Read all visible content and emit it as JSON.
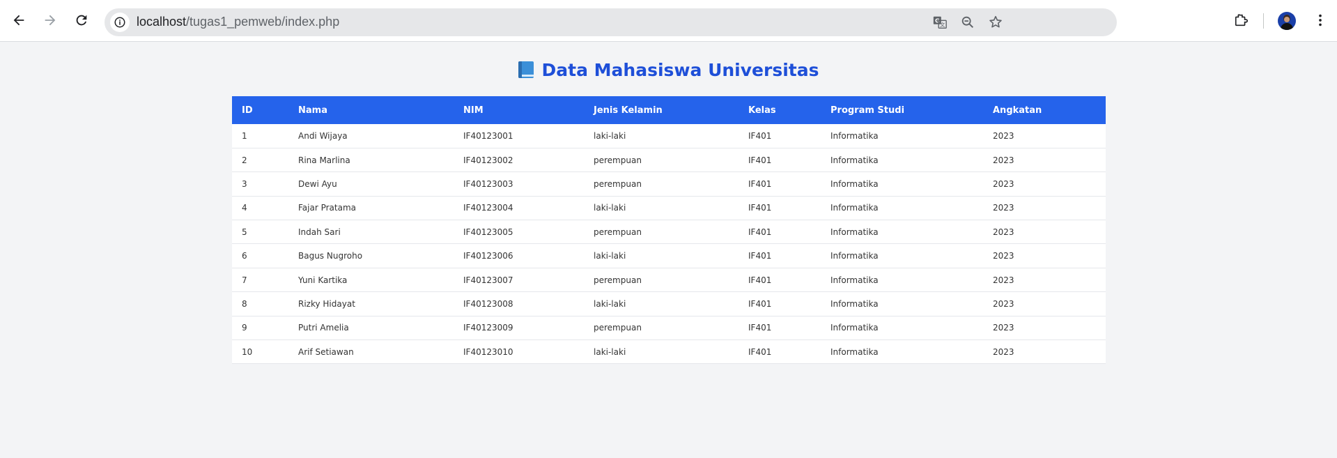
{
  "browser": {
    "url_host": "localhost",
    "url_path": "/tugas1_pemweb/index.php"
  },
  "page": {
    "title": "Data Mahasiswa Universitas"
  },
  "table": {
    "columns": [
      "ID",
      "Nama",
      "NIM",
      "Jenis Kelamin",
      "Kelas",
      "Program Studi",
      "Angkatan"
    ],
    "rows": [
      [
        "1",
        "Andi Wijaya",
        "IF40123001",
        "laki-laki",
        "IF401",
        "Informatika",
        "2023"
      ],
      [
        "2",
        "Rina Marlina",
        "IF40123002",
        "perempuan",
        "IF401",
        "Informatika",
        "2023"
      ],
      [
        "3",
        "Dewi Ayu",
        "IF40123003",
        "perempuan",
        "IF401",
        "Informatika",
        "2023"
      ],
      [
        "4",
        "Fajar Pratama",
        "IF40123004",
        "laki-laki",
        "IF401",
        "Informatika",
        "2023"
      ],
      [
        "5",
        "Indah Sari",
        "IF40123005",
        "perempuan",
        "IF401",
        "Informatika",
        "2023"
      ],
      [
        "6",
        "Bagus Nugroho",
        "IF40123006",
        "laki-laki",
        "IF401",
        "Informatika",
        "2023"
      ],
      [
        "7",
        "Yuni Kartika",
        "IF40123007",
        "perempuan",
        "IF401",
        "Informatika",
        "2023"
      ],
      [
        "8",
        "Rizky Hidayat",
        "IF40123008",
        "laki-laki",
        "IF401",
        "Informatika",
        "2023"
      ],
      [
        "9",
        "Putri Amelia",
        "IF40123009",
        "perempuan",
        "IF401",
        "Informatika",
        "2023"
      ],
      [
        "10",
        "Arif Setiawan",
        "IF40123010",
        "laki-laki",
        "IF401",
        "Informatika",
        "2023"
      ]
    ]
  },
  "colors": {
    "header_bg": "#2563eb",
    "title": "#1e4fd8",
    "page_bg": "#f3f4f6"
  }
}
